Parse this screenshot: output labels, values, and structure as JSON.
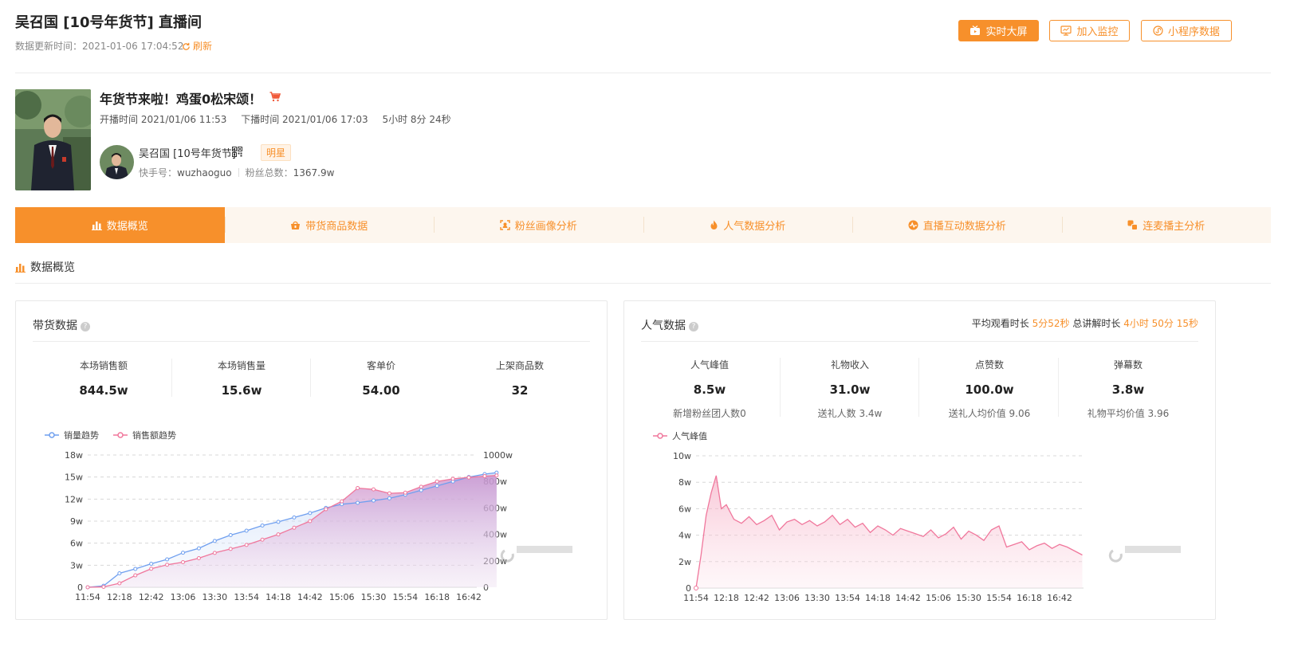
{
  "header": {
    "title": "吴召国 [10号年货节] 直播间",
    "updated_label": "数据更新时间：2021-01-06 17:04:52",
    "refresh_label": "刷新",
    "buttons": [
      "实时大屏",
      "加入监控",
      "小程序数据"
    ]
  },
  "live": {
    "title": "年货节来啦！鸡蛋0松宋颂！",
    "start": "开播时间 2021/01/06 11:53",
    "end": "下播时间 2021/01/06 17:03",
    "duration": "5小时 8分 24秒",
    "host_name": "吴召国 [10号年货节]",
    "badge": "明星",
    "kuaishou_label": "快手号：",
    "kuaishou_id": "wuzhaoguo",
    "fans_label": "粉丝总数：",
    "fans": "1367.9w"
  },
  "tabs": [
    "数据概览",
    "带货商品数据",
    "粉丝画像分析",
    "人气数据分析",
    "直播互动数据分析",
    "连麦播主分析"
  ],
  "section_title": "数据概览",
  "sales_card": {
    "title": "带货数据",
    "stats": [
      {
        "label": "本场销售额",
        "value": "844.5w"
      },
      {
        "label": "本场销售量",
        "value": "15.6w"
      },
      {
        "label": "客单价",
        "value": "54.00"
      },
      {
        "label": "上架商品数",
        "value": "32"
      }
    ]
  },
  "pop_card": {
    "title": "人气数据",
    "avg_watch_label": "平均观看时长",
    "avg_watch": "5分52秒",
    "explain_label": "总讲解时长",
    "explain": "4小时 50分 15秒",
    "stats": [
      {
        "label": "人气峰值",
        "value": "8.5w",
        "sub": "新增粉丝团人数0"
      },
      {
        "label": "礼物收入",
        "value": "31.0w",
        "sub": "送礼人数 3.4w"
      },
      {
        "label": "点赞数",
        "value": "100.0w",
        "sub": "送礼人均价值 9.06"
      },
      {
        "label": "弹幕数",
        "value": "3.8w",
        "sub": "礼物平均价值 3.96"
      }
    ]
  },
  "colors": {
    "accent": "#f7902b",
    "blue": "#6f9fef",
    "pink": "#f0779c"
  },
  "chart_data": [
    {
      "type": "area",
      "legend": [
        "销量趋势",
        "销售额趋势"
      ],
      "x": [
        "11:54",
        "12:06",
        "12:18",
        "12:30",
        "12:42",
        "12:54",
        "13:06",
        "13:18",
        "13:30",
        "13:42",
        "13:54",
        "14:06",
        "14:18",
        "14:30",
        "14:42",
        "14:54",
        "15:06",
        "15:18",
        "15:30",
        "15:42",
        "15:54",
        "16:06",
        "16:18",
        "16:30",
        "16:42",
        "16:54",
        "17:03"
      ],
      "xticks": [
        "11:54",
        "12:18",
        "12:42",
        "13:06",
        "13:30",
        "13:54",
        "14:18",
        "14:42",
        "15:06",
        "15:30",
        "15:54",
        "16:18",
        "16:42"
      ],
      "yticks_left": [
        "0",
        "3w",
        "6w",
        "9w",
        "12w",
        "15w",
        "18w"
      ],
      "yticks_right": [
        "0",
        "200w",
        "400w",
        "600w",
        "800w",
        "1000w"
      ],
      "ylim_left": [
        0,
        18
      ],
      "ylim_right": [
        0,
        1000
      ],
      "series": [
        {
          "name": "销量趋势",
          "axis": "left",
          "values": [
            0,
            0.2,
            1.9,
            2.5,
            3.2,
            3.8,
            4.7,
            5.3,
            6.3,
            7.1,
            7.7,
            8.4,
            8.9,
            9.5,
            10.1,
            10.8,
            11.3,
            11.5,
            11.8,
            12.1,
            12.6,
            13.2,
            13.8,
            14.4,
            15.0,
            15.4,
            15.6
          ]
        },
        {
          "name": "销售额趋势",
          "axis": "right",
          "values": [
            0,
            3,
            30,
            90,
            140,
            170,
            190,
            220,
            260,
            290,
            320,
            360,
            400,
            450,
            500,
            590,
            650,
            750,
            740,
            710,
            715,
            760,
            800,
            820,
            830,
            840,
            845
          ]
        }
      ]
    },
    {
      "type": "area",
      "legend": [
        "人气峰值"
      ],
      "x": [
        "11:54",
        "11:58",
        "12:02",
        "12:06",
        "12:10",
        "12:14",
        "12:18",
        "12:24",
        "12:30",
        "12:36",
        "12:42",
        "12:48",
        "12:54",
        "13:00",
        "13:06",
        "13:12",
        "13:18",
        "13:24",
        "13:30",
        "13:36",
        "13:42",
        "13:48",
        "13:54",
        "14:00",
        "14:06",
        "14:12",
        "14:18",
        "14:24",
        "14:30",
        "14:36",
        "14:42",
        "14:48",
        "14:54",
        "15:00",
        "15:06",
        "15:12",
        "15:18",
        "15:24",
        "15:30",
        "15:36",
        "15:42",
        "15:48",
        "15:54",
        "16:00",
        "16:06",
        "16:12",
        "16:18",
        "16:24",
        "16:30",
        "16:36",
        "16:42",
        "16:48",
        "16:54",
        "17:00"
      ],
      "xticks": [
        "11:54",
        "12:18",
        "12:42",
        "13:06",
        "13:30",
        "13:54",
        "14:18",
        "14:42",
        "15:06",
        "15:30",
        "15:54",
        "16:18",
        "16:42"
      ],
      "yticks": [
        "0",
        "2w",
        "4w",
        "6w",
        "8w",
        "10w"
      ],
      "ylim": [
        0,
        10
      ],
      "series": [
        {
          "name": "人气峰值",
          "values": [
            0,
            2.5,
            5.5,
            7.2,
            8.5,
            6.0,
            6.3,
            5.2,
            4.9,
            5.4,
            4.8,
            5.1,
            5.5,
            4.4,
            5.0,
            5.2,
            4.8,
            5.1,
            4.7,
            5.0,
            5.5,
            4.8,
            5.2,
            4.6,
            4.9,
            4.2,
            4.7,
            4.4,
            4.0,
            4.5,
            4.3,
            4.1,
            3.9,
            4.4,
            3.8,
            4.1,
            4.6,
            3.7,
            4.3,
            4.0,
            3.6,
            4.4,
            4.7,
            3.1,
            3.3,
            3.5,
            2.9,
            3.2,
            3.4,
            3.0,
            3.3,
            3.1,
            2.8,
            2.5
          ]
        }
      ]
    }
  ]
}
